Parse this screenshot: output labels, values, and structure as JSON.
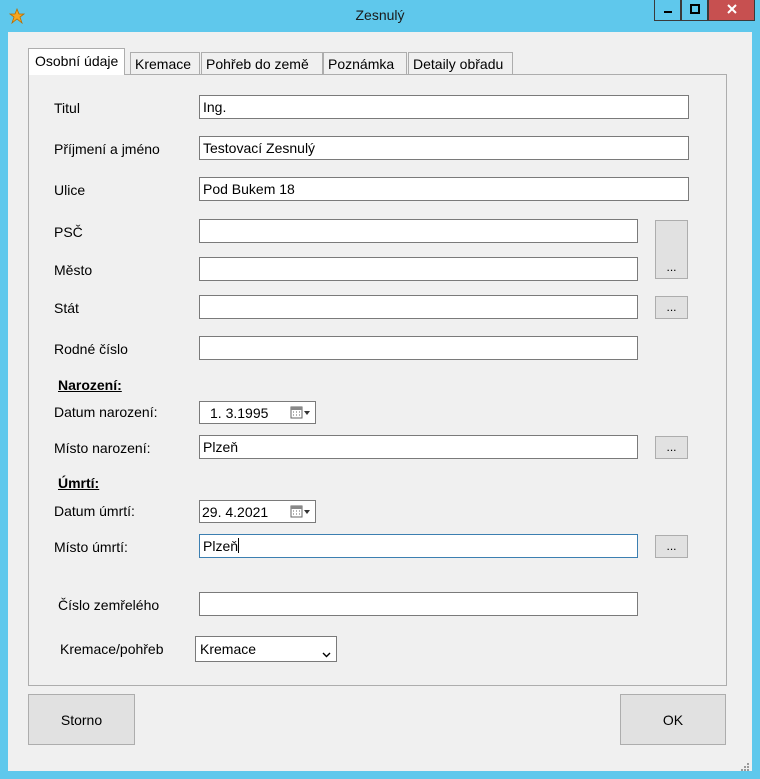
{
  "window": {
    "title": "Zesnulý",
    "accent": "#5fc8ec",
    "close_color": "#c75050"
  },
  "tabs": [
    {
      "label": "Osobní údaje"
    },
    {
      "label": "Kremace"
    },
    {
      "label": "Pohřeb do země"
    },
    {
      "label": "Poznámka"
    },
    {
      "label": "Detaily obřadu"
    }
  ],
  "form": {
    "titul": {
      "label": "Titul",
      "value": "Ing."
    },
    "jmeno": {
      "label": "Příjmení a jméno",
      "value": "Testovací Zesnulý"
    },
    "ulice": {
      "label": "Ulice",
      "value": "Pod Bukem 18"
    },
    "psc": {
      "label": "PSČ",
      "value": ""
    },
    "mesto": {
      "label": "Město",
      "value": ""
    },
    "stat": {
      "label": "Stát",
      "value": ""
    },
    "rodne_cislo": {
      "label": "Rodné číslo",
      "value": ""
    },
    "browse_label": "...",
    "narozeni": {
      "heading": "Narození:",
      "datum_label": "Datum narození:",
      "datum_value": "1.  3.1995",
      "misto_label": "Místo narození:",
      "misto_value": "Plzeň"
    },
    "umrti": {
      "heading": "Úmrtí:",
      "datum_label": "Datum úmrtí:",
      "datum_value": "29.  4.2021",
      "misto_label": "Místo úmrtí:",
      "misto_value": "Plzeň"
    },
    "cislo": {
      "label": "Číslo zemřelého",
      "value": ""
    },
    "kremace": {
      "label": "Kremace/pohřeb",
      "selected": "Kremace"
    }
  },
  "buttons": {
    "storno": "Storno",
    "ok": "OK"
  }
}
